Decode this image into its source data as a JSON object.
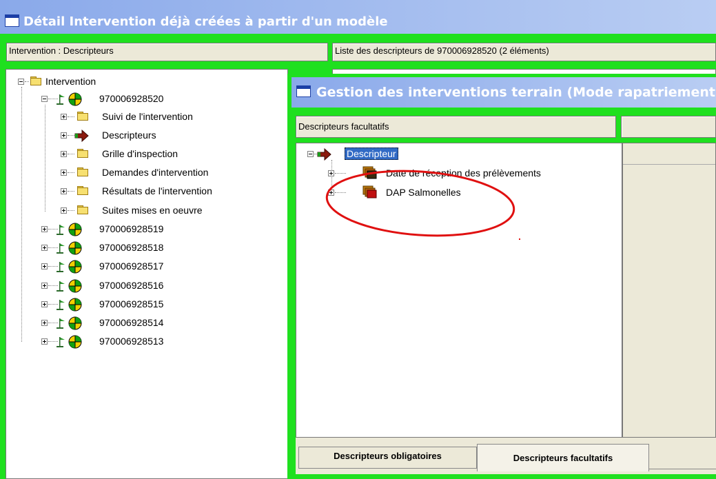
{
  "outer_window": {
    "title": "Détail Intervention déjà créées à partir d'un modèle",
    "left_header": "Intervention : Descripteurs",
    "right_header": "Liste des descripteurs de  970006928520 (2 éléments)"
  },
  "tree": {
    "root_label": "Intervention",
    "expanded_item": {
      "id": "970006928520",
      "children": [
        {
          "label": "Suivi de l'intervention",
          "icon": "folder-icon"
        },
        {
          "label": "Descripteurs",
          "icon": "arrow-right-icon"
        },
        {
          "label": "Grille d'inspection",
          "icon": "folder-icon"
        },
        {
          "label": "Demandes d'intervention",
          "icon": "folder-icon"
        },
        {
          "label": "Résultats de l'intervention",
          "icon": "folder-icon"
        },
        {
          "label": "Suites mises en oeuvre",
          "icon": "folder-icon"
        }
      ]
    },
    "collapsed_items": [
      "970006928519",
      "970006928518",
      "970006928517",
      "970006928516",
      "970006928515",
      "970006928514",
      "970006928513"
    ]
  },
  "inner_window": {
    "title": "Gestion des interventions terrain (Mode rapatriement)",
    "header": "Descripteurs facultatifs",
    "tree_root": "Descripteur",
    "tree_items": [
      "Date de réception des prélèvements",
      "DAP Salmonelles"
    ],
    "tabs": [
      "Descripteurs obligatoires",
      "Descripteurs facultatifs"
    ],
    "active_tab": "Descripteurs facultatifs"
  },
  "colors": {
    "frame_green": "#1fe01f",
    "title_blue": "#8aa9ea",
    "selection_blue": "#316ac5",
    "annotation_red": "#e01010"
  }
}
